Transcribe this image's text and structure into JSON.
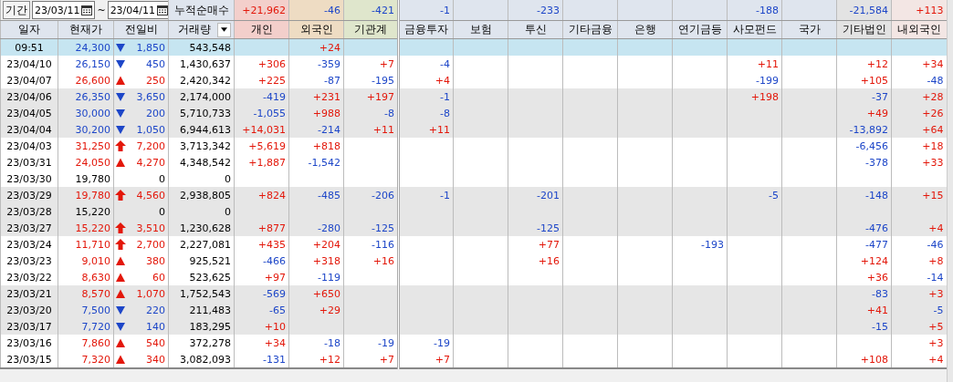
{
  "toolbar": {
    "period_button": "기간",
    "start_date": "23/03/11",
    "separator": "~",
    "end_date": "23/04/11",
    "cumulative_label": "누적순매수"
  },
  "sums": {
    "individual": "+21,962",
    "foreign": "-46",
    "institution": "-421",
    "financial_investment": "-1",
    "investment_trust": "-233",
    "private_fund": "-188",
    "other_corp": "-21,584",
    "other_foreign": "+113"
  },
  "columns": [
    "일자",
    "현재가",
    "전일비",
    "거래량",
    "개인",
    "외국인",
    "기관계",
    "금융투자",
    "보험",
    "투신",
    "기타금융",
    "은행",
    "연기금등",
    "사모펀드",
    "국가",
    "기타법인",
    "내외국인"
  ],
  "rows": [
    {
      "date": "09:51",
      "selected": true,
      "kind": "down",
      "price": "24,300",
      "change": "1,850",
      "volume": "543,548",
      "flows": {
        "foreign": "+24"
      }
    },
    {
      "date": "23/04/10",
      "selected": false,
      "kind": "down",
      "price": "26,150",
      "change": "450",
      "volume": "1,430,637",
      "flows": {
        "individual": "+306",
        "foreign": "-359",
        "institution": "+7",
        "financial_investment": "-4",
        "private_fund": "+11",
        "other_corp": "+12",
        "other_foreign": "+34"
      }
    },
    {
      "date": "23/04/07",
      "selected": false,
      "kind": "up",
      "price": "26,600",
      "change": "250",
      "volume": "2,420,342",
      "flows": {
        "individual": "+225",
        "foreign": "-87",
        "institution": "-195",
        "financial_investment": "+4",
        "private_fund": "-199",
        "other_corp": "+105",
        "other_foreign": "-48"
      }
    },
    {
      "date": "23/04/06",
      "selected": false,
      "kind": "down",
      "price": "26,350",
      "change": "3,650",
      "volume": "2,174,000",
      "flows": {
        "individual": "-419",
        "foreign": "+231",
        "institution": "+197",
        "financial_investment": "-1",
        "private_fund": "+198",
        "other_corp": "-37",
        "other_foreign": "+28"
      }
    },
    {
      "date": "23/04/05",
      "selected": false,
      "kind": "down",
      "price": "30,000",
      "change": "200",
      "volume": "5,710,733",
      "flows": {
        "individual": "-1,055",
        "foreign": "+988",
        "institution": "-8",
        "financial_investment": "-8",
        "other_corp": "+49",
        "other_foreign": "+26"
      }
    },
    {
      "date": "23/04/04",
      "selected": false,
      "kind": "down",
      "price": "30,200",
      "change": "1,050",
      "volume": "6,944,613",
      "flows": {
        "individual": "+14,031",
        "foreign": "-214",
        "institution": "+11",
        "financial_investment": "+11",
        "other_corp": "-13,892",
        "other_foreign": "+64"
      }
    },
    {
      "date": "23/04/03",
      "selected": false,
      "kind": "limit_up",
      "price": "31,250",
      "change": "7,200",
      "volume": "3,713,342",
      "flows": {
        "individual": "+5,619",
        "foreign": "+818",
        "other_corp": "-6,456",
        "other_foreign": "+18"
      }
    },
    {
      "date": "23/03/31",
      "selected": false,
      "kind": "up",
      "price": "24,050",
      "change": "4,270",
      "volume": "4,348,542",
      "flows": {
        "individual": "+1,887",
        "foreign": "-1,542",
        "other_corp": "-378",
        "other_foreign": "+33"
      }
    },
    {
      "date": "23/03/30",
      "selected": false,
      "kind": "flat",
      "price": "19,780",
      "change": "0",
      "volume": "0"
    },
    {
      "date": "23/03/29",
      "selected": false,
      "kind": "limit_up",
      "price": "19,780",
      "change": "4,560",
      "volume": "2,938,805",
      "flows": {
        "individual": "+824",
        "foreign": "-485",
        "institution": "-206",
        "financial_investment": "-1",
        "investment_trust": "-201",
        "private_fund": "-5",
        "other_corp": "-148",
        "other_foreign": "+15"
      }
    },
    {
      "date": "23/03/28",
      "selected": false,
      "kind": "flat",
      "price": "15,220",
      "change": "0",
      "volume": "0"
    },
    {
      "date": "23/03/27",
      "selected": false,
      "kind": "limit_up",
      "price": "15,220",
      "change": "3,510",
      "volume": "1,230,628",
      "flows": {
        "individual": "+877",
        "foreign": "-280",
        "institution": "-125",
        "investment_trust": "-125",
        "other_corp": "-476",
        "other_foreign": "+4"
      }
    },
    {
      "date": "23/03/24",
      "selected": false,
      "kind": "limit_up",
      "price": "11,710",
      "change": "2,700",
      "volume": "2,227,081",
      "flows": {
        "individual": "+435",
        "foreign": "+204",
        "institution": "-116",
        "investment_trust": "+77",
        "pension": "-193",
        "other_corp": "-477",
        "other_foreign": "-46"
      }
    },
    {
      "date": "23/03/23",
      "selected": false,
      "kind": "up",
      "price": "9,010",
      "change": "380",
      "volume": "925,521",
      "flows": {
        "individual": "-466",
        "foreign": "+318",
        "institution": "+16",
        "investment_trust": "+16",
        "other_corp": "+124",
        "other_foreign": "+8"
      }
    },
    {
      "date": "23/03/22",
      "selected": false,
      "kind": "up",
      "price": "8,630",
      "change": "60",
      "volume": "523,625",
      "flows": {
        "individual": "+97",
        "foreign": "-119",
        "other_corp": "+36",
        "other_foreign": "-14"
      }
    },
    {
      "date": "23/03/21",
      "selected": false,
      "kind": "up",
      "price": "8,570",
      "change": "1,070",
      "volume": "1,752,543",
      "flows": {
        "individual": "-569",
        "foreign": "+650",
        "other_corp": "-83",
        "other_foreign": "+3"
      }
    },
    {
      "date": "23/03/20",
      "selected": false,
      "kind": "down",
      "price": "7,500",
      "change": "220",
      "volume": "211,483",
      "flows": {
        "individual": "-65",
        "foreign": "+29",
        "other_corp": "+41",
        "other_foreign": "-5"
      }
    },
    {
      "date": "23/03/17",
      "selected": false,
      "kind": "down",
      "price": "7,720",
      "change": "140",
      "volume": "183,295",
      "flows": {
        "individual": "+10",
        "other_corp": "-15",
        "other_foreign": "+5"
      }
    },
    {
      "date": "23/03/16",
      "selected": false,
      "kind": "up",
      "price": "7,860",
      "change": "540",
      "volume": "372,278",
      "flows": {
        "individual": "+34",
        "foreign": "-18",
        "institution": "-19",
        "financial_investment": "-19",
        "other_foreign": "+3"
      }
    },
    {
      "date": "23/03/15",
      "selected": false,
      "kind": "up",
      "price": "7,320",
      "change": "340",
      "volume": "3,082,093",
      "flows": {
        "individual": "-131",
        "foreign": "+12",
        "institution": "+7",
        "financial_investment": "+7",
        "other_corp": "+108",
        "other_foreign": "+4"
      }
    }
  ]
}
